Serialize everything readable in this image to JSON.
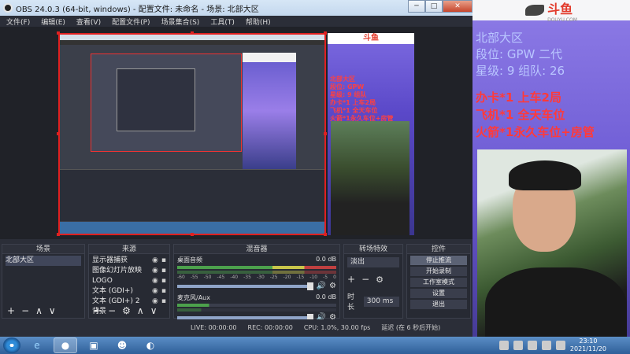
{
  "window": {
    "title": "OBS 24.0.3 (64-bit, windows) - 配置文件: 未命名 - 场景: 北部大区",
    "min": "─",
    "max": "□",
    "close": "✕"
  },
  "menu": [
    "文件(F)",
    "编辑(E)",
    "查看(V)",
    "配置文件(P)",
    "场景集合(S)",
    "工具(T)",
    "帮助(H)"
  ],
  "poster": {
    "logo": "斗鱼",
    "lines": [
      "北部大区",
      "段位: GPW",
      "星级: 9 组队",
      "办卡*1 上车2局",
      "飞机*1 全天车位",
      "火箭*1永久车位+房管"
    ]
  },
  "docks": {
    "scenes": {
      "title": "场景",
      "items": [
        "北部大区"
      ]
    },
    "sources": {
      "title": "来源",
      "items": [
        "显示器捕获",
        "图像幻灯片放映",
        "LOGO",
        "文本 (GDI+)",
        "文本 (GDI+) 2",
        "背景"
      ]
    },
    "mixer": {
      "title": "混音器",
      "channels": [
        {
          "name": "桌面音频",
          "db": "0.0 dB"
        },
        {
          "name": "麦克风/Aux",
          "db": "0.0 dB"
        }
      ],
      "scale": [
        "-60",
        "-55",
        "-50",
        "-45",
        "-40",
        "-35",
        "-30",
        "-25",
        "-20",
        "-15",
        "-10",
        "-5",
        "0"
      ]
    },
    "transitions": {
      "title": "转场特效",
      "type": "淡出",
      "duration_label": "时长",
      "duration": "300 ms"
    },
    "controls": {
      "title": "控件",
      "buttons": [
        "停止推流",
        "开始录制",
        "工作室模式",
        "设置",
        "退出"
      ]
    }
  },
  "status": {
    "live": "LIVE: 00:00:00",
    "rec": "REC: 00:00:00",
    "cpu": "CPU: 1.0%, 30.00 fps",
    "delay": "延迟 (在 6 秒后开始)"
  },
  "side": {
    "logo": "斗鱼",
    "logo_sub": "DOUYU.COM",
    "info": [
      "北部大区",
      "段位: GPW 二代",
      "星级: 9 组队: 26"
    ],
    "offers": [
      "办卡*1 上车2局",
      "飞机*1 全天车位",
      "火箭*1永久车位+房管"
    ]
  },
  "taskbar": {
    "time": "23:10",
    "date": "2021/11/20"
  },
  "icons": {
    "add": "+",
    "remove": "−",
    "up": "∧",
    "down": "∨",
    "gear": "⚙",
    "eye": "👁",
    "lock": "🔒",
    "speaker": "🔊"
  }
}
